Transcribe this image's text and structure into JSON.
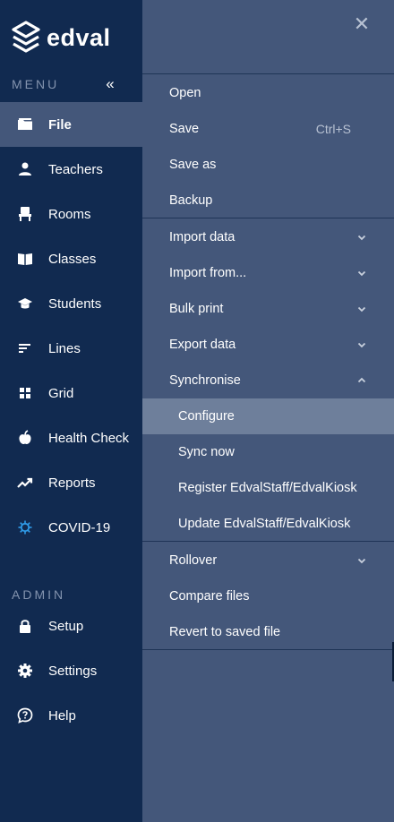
{
  "brand": {
    "name": "edval"
  },
  "sidebar": {
    "menu_label": "MENU",
    "admin_label": "ADMIN",
    "collapse_icon": "double-chevron-left-icon",
    "items": [
      {
        "label": "File",
        "icon": "folder-icon",
        "active": true
      },
      {
        "label": "Teachers",
        "icon": "person-icon"
      },
      {
        "label": "Rooms",
        "icon": "chair-icon"
      },
      {
        "label": "Classes",
        "icon": "book-icon"
      },
      {
        "label": "Students",
        "icon": "graduation-cap-icon"
      },
      {
        "label": "Lines",
        "icon": "lines-icon"
      },
      {
        "label": "Grid",
        "icon": "grid-icon"
      },
      {
        "label": "Health Check",
        "icon": "apple-icon"
      },
      {
        "label": "Reports",
        "icon": "trend-icon"
      },
      {
        "label": "COVID-19",
        "icon": "virus-icon",
        "color": "#2f9be8"
      }
    ],
    "admin_items": [
      {
        "label": "Setup",
        "icon": "lock-icon"
      },
      {
        "label": "Settings",
        "icon": "gear-icon"
      },
      {
        "label": "Help",
        "icon": "help-icon"
      }
    ]
  },
  "file_menu": {
    "close_icon": "close-icon",
    "group1": [
      {
        "label": "Open"
      },
      {
        "label": "Save",
        "shortcut": "Ctrl+S"
      },
      {
        "label": "Save as"
      },
      {
        "label": "Backup"
      }
    ],
    "group2": [
      {
        "label": "Import data",
        "expand": "down"
      },
      {
        "label": "Import from...",
        "expand": "down"
      },
      {
        "label": "Bulk print",
        "expand": "down"
      },
      {
        "label": "Export data",
        "expand": "down"
      },
      {
        "label": "Synchronise",
        "expand": "up"
      }
    ],
    "synchronise_items": [
      {
        "label": "Configure",
        "highlighted": true
      },
      {
        "label": "Sync now"
      },
      {
        "label": "Register EdvalStaff/EdvalKiosk"
      },
      {
        "label": "Update EdvalStaff/EdvalKiosk"
      }
    ],
    "group3": [
      {
        "label": "Rollover",
        "expand": "down"
      },
      {
        "label": "Compare files"
      },
      {
        "label": "Revert to saved file"
      }
    ]
  },
  "colors": {
    "sidebar_bg": "#112a50",
    "panel_bg": "#44577a",
    "highlight_bg": "#6e7f9b",
    "muted_text": "#8393ae"
  }
}
